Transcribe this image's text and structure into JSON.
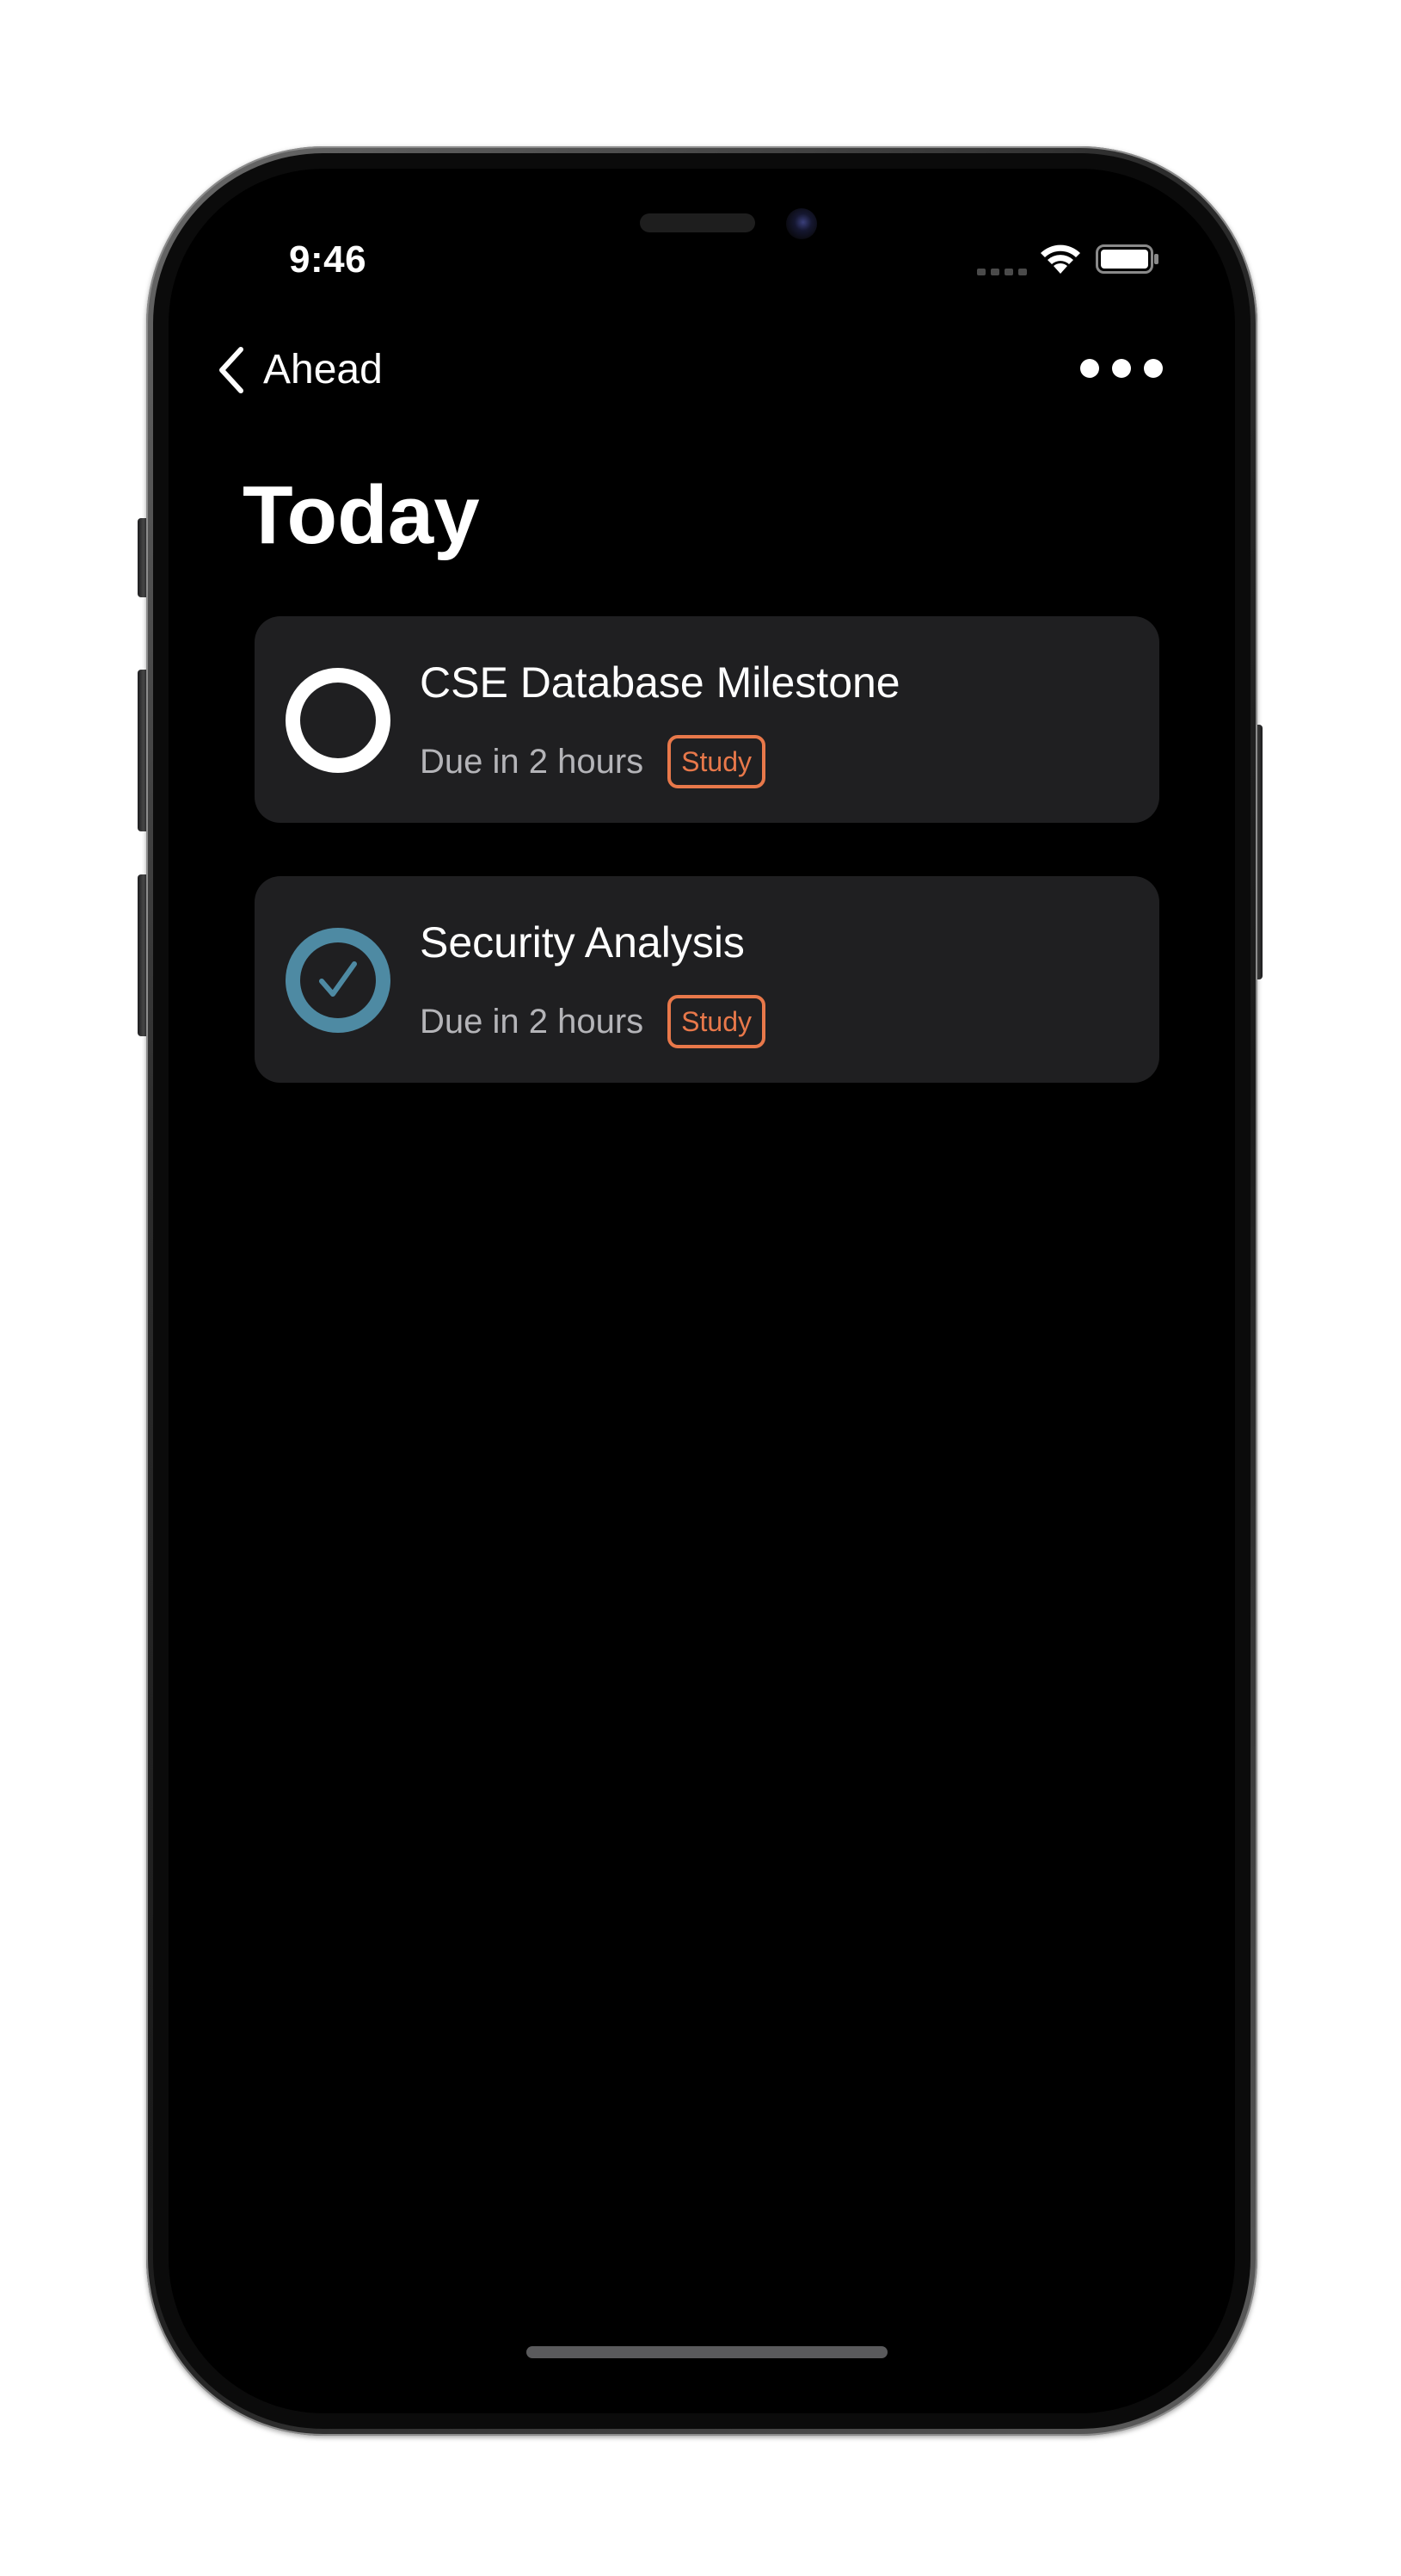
{
  "status_bar": {
    "time": "9:46",
    "icons": [
      "cellular-signal-icon",
      "wifi-icon",
      "battery-icon"
    ]
  },
  "nav": {
    "back_label": "Ahead",
    "back_icon": "chevron-left-icon",
    "more_icon": "ellipsis-icon"
  },
  "page": {
    "title": "Today"
  },
  "tasks": [
    {
      "title": "CSE Database Milestone",
      "due": "Due in 2 hours",
      "tag": "Study",
      "completed": false,
      "icon": "unchecked-circle-icon"
    },
    {
      "title": "Security Analysis",
      "due": "Due in 2 hours",
      "tag": "Study",
      "completed": true,
      "icon": "checked-circle-icon"
    }
  ],
  "colors": {
    "background": "#000000",
    "card": "#1f1f21",
    "text_primary": "#ffffff",
    "text_secondary": "#b4b4b8",
    "tag_accent": "#e8784a",
    "check_accent": "#4e8aa3"
  }
}
